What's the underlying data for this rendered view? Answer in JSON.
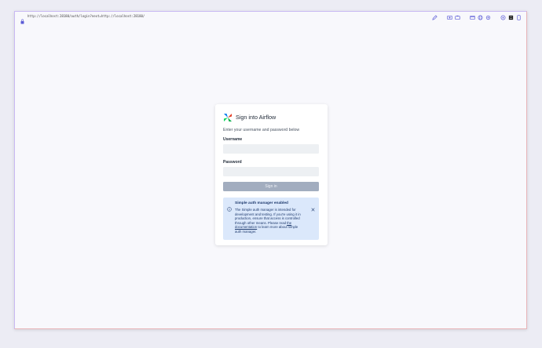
{
  "browser": {
    "url": "http://localhost:28180/auth/login?next=http://localhost:28180/"
  },
  "login": {
    "title": "Sign into Airflow",
    "subtitle": "Enter your username and password below",
    "username_label": "Username",
    "username_value": "",
    "password_label": "Password",
    "password_value": "",
    "signin_label": "Sign in"
  },
  "alert": {
    "title": "Simple auth manager enabled",
    "body_before_link": "The Simple auth manager is intended for development and testing. If you're using it in production, ensure that access is controlled through other means. Please read ",
    "link_text": "the documentation",
    "body_after_link": " to learn more about simple auth manager."
  },
  "icons": {
    "lock": "lock-icon",
    "logo": "airflow-logo-icon",
    "info": "info-icon",
    "close": "close-icon"
  },
  "colors": {
    "signin_button": "#a2adbf",
    "alert_background": "#dbe8fb",
    "alert_text": "#1e3a6e",
    "toolbar_icon": "#4f46e5"
  }
}
